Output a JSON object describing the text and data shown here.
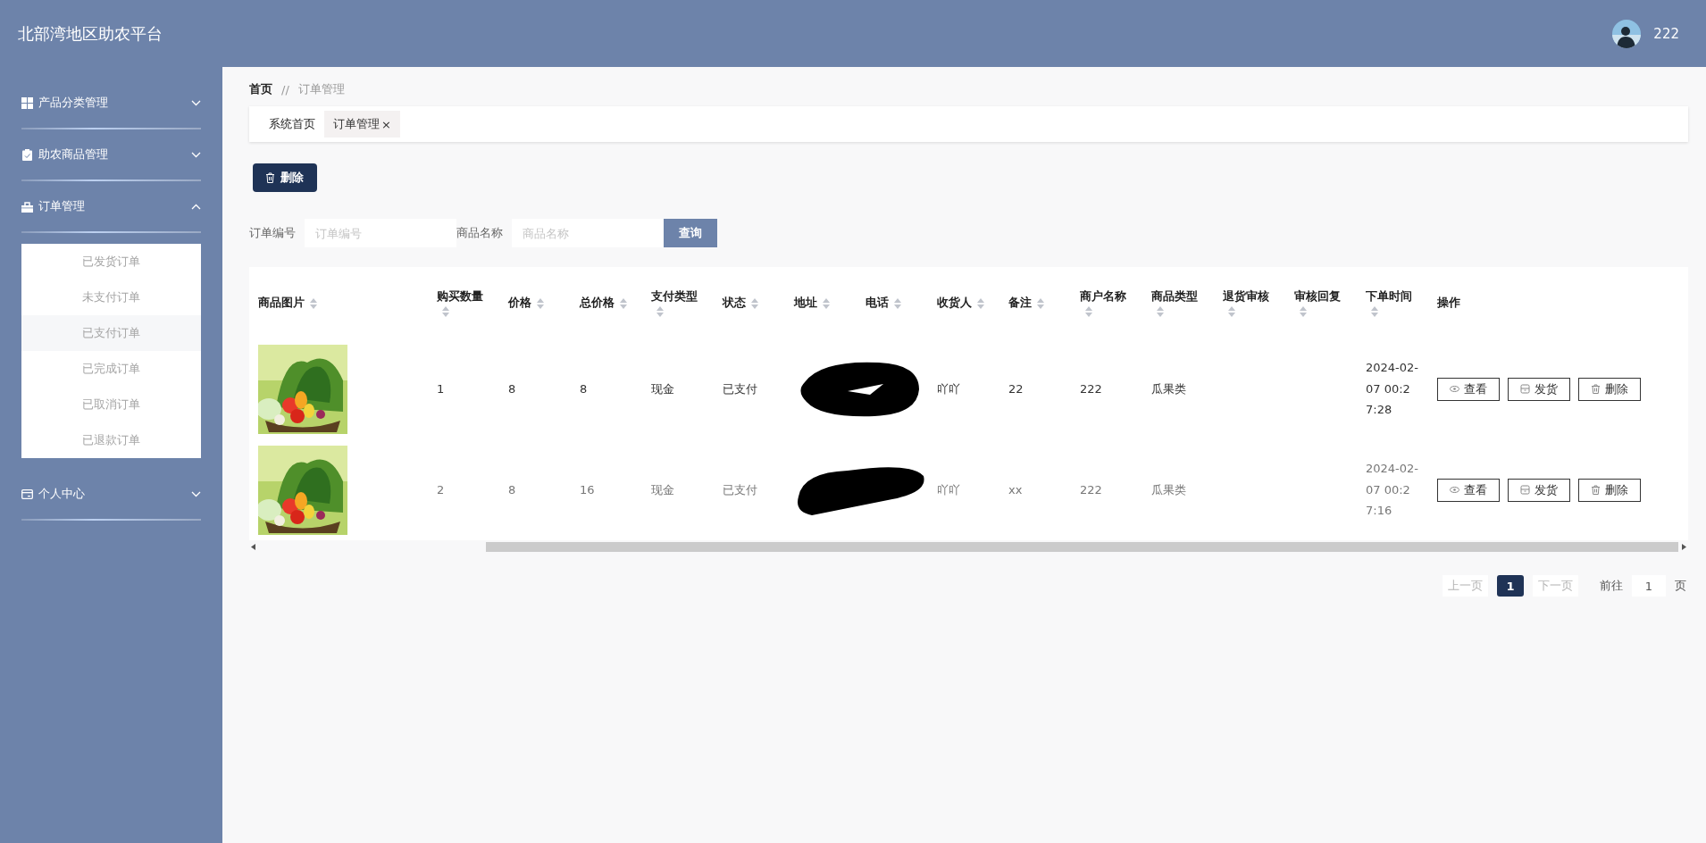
{
  "header": {
    "title": "北部湾地区助农平台",
    "user": "222"
  },
  "sidebar": {
    "items": [
      {
        "label": "产品分类管理",
        "expanded": false
      },
      {
        "label": "助农商品管理",
        "expanded": false
      },
      {
        "label": "订单管理",
        "expanded": true,
        "children": [
          {
            "label": "已发货订单",
            "selected": false
          },
          {
            "label": "未支付订单",
            "selected": false
          },
          {
            "label": "已支付订单",
            "selected": true
          },
          {
            "label": "已完成订单",
            "selected": false
          },
          {
            "label": "已取消订单",
            "selected": false
          },
          {
            "label": "已退款订单",
            "selected": false
          }
        ]
      },
      {
        "label": "个人中心",
        "expanded": false
      }
    ]
  },
  "breadcrumb": [
    "首页",
    "//",
    "订单管理"
  ],
  "tabs": [
    {
      "label": "系统首页",
      "selected": false,
      "closable": false
    },
    {
      "label": "订单管理",
      "selected": true,
      "closable": true,
      "close": "×"
    }
  ],
  "toolbar": {
    "delete_button": "删除"
  },
  "search": {
    "fields": [
      {
        "label": "订单编号",
        "placeholder": "订单编号"
      },
      {
        "label": "商品名称",
        "placeholder": "商品名称"
      }
    ],
    "button": "查询"
  },
  "table": {
    "columns": [
      {
        "label": "商品图片",
        "sortable": true
      },
      {
        "label": "购买数量",
        "sortable": true
      },
      {
        "label": "价格",
        "sortable": true
      },
      {
        "label": "总价格",
        "sortable": true
      },
      {
        "label": "支付类型",
        "sortable": true
      },
      {
        "label": "状态",
        "sortable": true
      },
      {
        "label": "地址",
        "sortable": true
      },
      {
        "label": "电话",
        "sortable": true
      },
      {
        "label": "收货人",
        "sortable": true
      },
      {
        "label": "备注",
        "sortable": true
      },
      {
        "label": "商户名称",
        "sortable": true
      },
      {
        "label": "商品类型",
        "sortable": true
      },
      {
        "label": "退货审核",
        "sortable": true
      },
      {
        "label": "审核回复",
        "sortable": true
      },
      {
        "label": "下单时间",
        "sortable": true
      },
      {
        "label": "操作",
        "sortable": false
      }
    ],
    "rows": [
      {
        "image": {
          "kind": "picture"
        },
        "quantity": "1",
        "price": "8",
        "total": "8",
        "pay_type": "现金",
        "status": "已支付",
        "redacted": true,
        "receiver": "吖吖",
        "remark": "22",
        "merchant": "222",
        "category": "瓜果类",
        "order_time": "2024-02-07 00:27:28",
        "actions": [
          "查看",
          "发货",
          "删除"
        ]
      },
      {
        "image": {
          "kind": "picture"
        },
        "quantity": "2",
        "price": "8",
        "total": "16",
        "pay_type": "现金",
        "status": "已支付",
        "redacted": true,
        "receiver": "吖吖",
        "remark": "xx",
        "merchant": "222",
        "category": "瓜果类",
        "order_time": "2024-02-07 00:27:16",
        "actions": [
          "查看",
          "发货",
          "删除"
        ]
      }
    ]
  },
  "pagination": {
    "prev": "上一页",
    "pages": [
      {
        "label": "1",
        "selected": true
      }
    ],
    "next": "下一页",
    "goto_label": "前往",
    "goto_value": "1",
    "page_suffix": "页"
  }
}
